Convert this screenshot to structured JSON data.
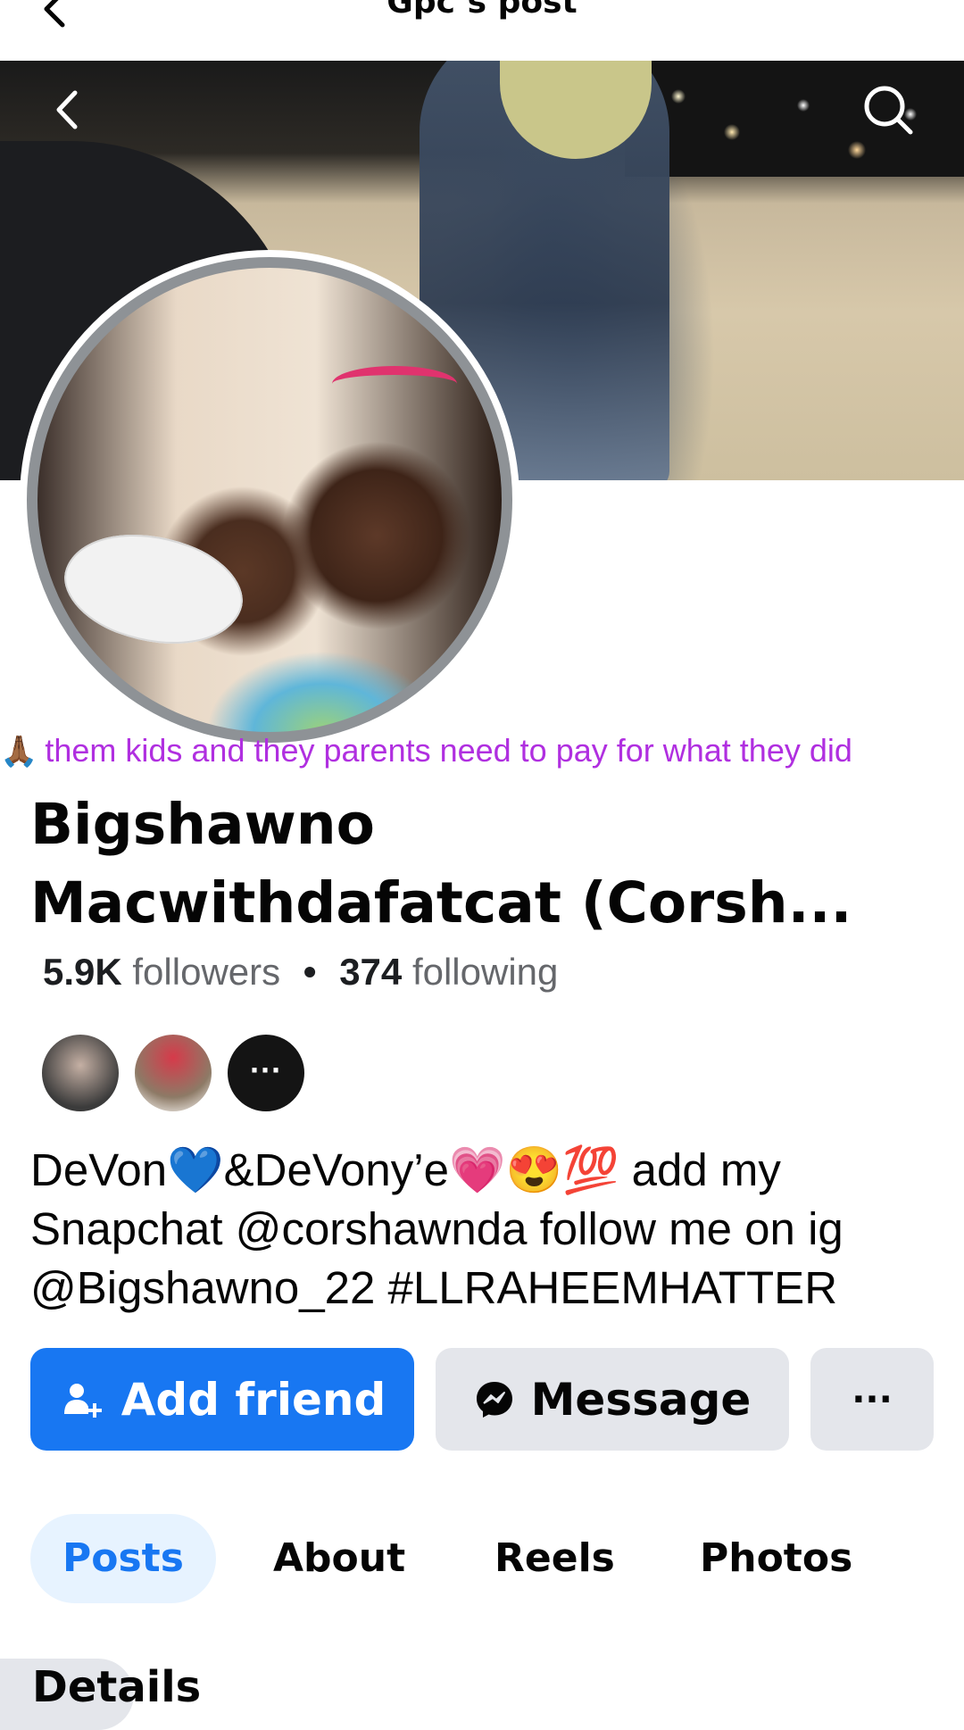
{
  "header": {
    "title": "Gpc’s post"
  },
  "post_overlay": {
    "emoji": "🙏🏾",
    "text": "them kids and they parents need to pay for what they did"
  },
  "profile": {
    "name": "Bigshawno Macwithdafatcat (Corsh...",
    "followers_count": "5.9K",
    "followers_label": "followers",
    "separator": "•",
    "following_count": "374",
    "following_label": "following",
    "mutuals_more": "···",
    "bio": "DeVon💙&DeVony’e💗😍💯 add my Snapchat @corshawnda follow me on ig @Bigshawno_22 #LLRAHEEMHATTER"
  },
  "actions": {
    "add_friend": "Add friend",
    "message": "Message",
    "more": "···"
  },
  "tabs": [
    {
      "label": "Posts",
      "active": true
    },
    {
      "label": "About",
      "active": false
    },
    {
      "label": "Reels",
      "active": false
    },
    {
      "label": "Photos",
      "active": false
    }
  ],
  "details_label": "Details",
  "colors": {
    "primary": "#1877f2",
    "overlay_text": "#b02fe0",
    "button_gray": "#e4e6eb",
    "tab_active_bg": "#e7f3ff"
  }
}
